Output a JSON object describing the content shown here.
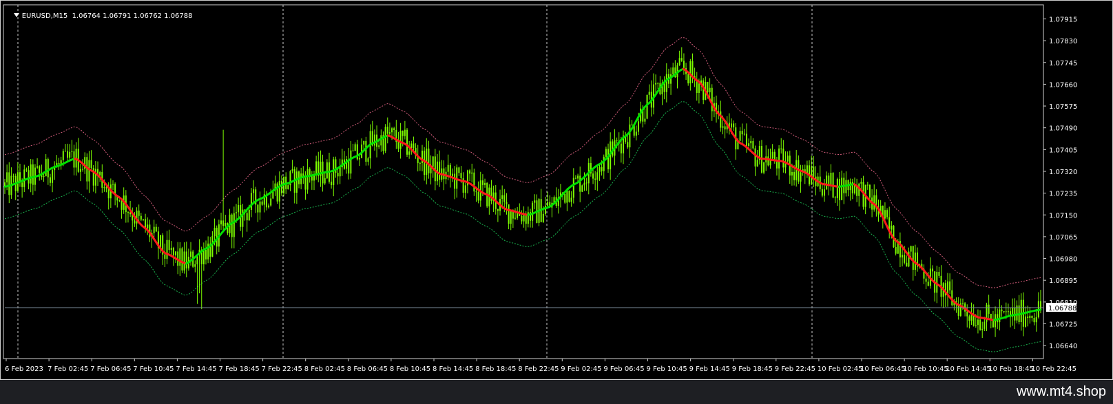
{
  "header": {
    "symbol": "EURUSD,M15",
    "ohlc": "1.06764 1.06791 1.06762 1.06788"
  },
  "watermark": "www.mt4.shop",
  "colors": {
    "background": "#000000",
    "candles": "#7cfc00",
    "ma_up": "#00e000",
    "ma_down": "#ff1a1a",
    "ma_flat": "#ffd700",
    "band_upper": "#d05c7a",
    "band_lower": "#19b24d",
    "grid": "#c8c8c8",
    "bid_line": "#7a8a99"
  },
  "chart_data": {
    "type": "candlestick",
    "symbol": "EURUSD",
    "timeframe": "M15",
    "current_price": 1.06788,
    "y_ticks": [
      1.07915,
      1.0783,
      1.07745,
      1.0766,
      1.07575,
      1.0749,
      1.07405,
      1.0732,
      1.07235,
      1.0715,
      1.07065,
      1.0698,
      1.06895,
      1.0681,
      1.06725,
      1.0664
    ],
    "ylim": [
      1.066,
      1.0797
    ],
    "x_ticks": [
      "6 Feb 2023",
      "7 Feb 02:45",
      "7 Feb 06:45",
      "7 Feb 10:45",
      "7 Feb 14:45",
      "7 Feb 18:45",
      "7 Feb 22:45",
      "8 Feb 02:45",
      "8 Feb 06:45",
      "8 Feb 10:45",
      "8 Feb 14:45",
      "8 Feb 18:45",
      "8 Feb 22:45",
      "9 Feb 02:45",
      "9 Feb 06:45",
      "9 Feb 10:45",
      "9 Feb 14:45",
      "9 Feb 18:45",
      "9 Feb 22:45",
      "10 Feb 02:45",
      "10 Feb 06:45",
      "10 Feb 10:45",
      "10 Feb 14:45",
      "10 Feb 18:45",
      "10 Feb 22:45"
    ],
    "day_separators": [
      "7 Feb 00:00",
      "8 Feb 00:00",
      "9 Feb 00:00",
      "10 Feb 00:00"
    ],
    "ma_profile": [
      [
        0.0,
        1.0726
      ],
      [
        0.03,
        1.073
      ],
      [
        0.05,
        1.0734
      ],
      [
        0.068,
        1.0737
      ],
      [
        0.085,
        1.0732
      ],
      [
        0.11,
        1.0722
      ],
      [
        0.135,
        1.071
      ],
      [
        0.155,
        1.07
      ],
      [
        0.175,
        1.0696
      ],
      [
        0.195,
        1.0702
      ],
      [
        0.22,
        1.0712
      ],
      [
        0.245,
        1.0721
      ],
      [
        0.27,
        1.0727
      ],
      [
        0.29,
        1.073
      ],
      [
        0.315,
        1.0732
      ],
      [
        0.34,
        1.0738
      ],
      [
        0.355,
        1.0743
      ],
      [
        0.37,
        1.0746
      ],
      [
        0.385,
        1.0743
      ],
      [
        0.405,
        1.0736
      ],
      [
        0.42,
        1.0731
      ],
      [
        0.445,
        1.0728
      ],
      [
        0.465,
        1.0723
      ],
      [
        0.485,
        1.0717
      ],
      [
        0.505,
        1.0715
      ],
      [
        0.525,
        1.0718
      ],
      [
        0.55,
        1.0727
      ],
      [
        0.575,
        1.0735
      ],
      [
        0.6,
        1.0746
      ],
      [
        0.62,
        1.0758
      ],
      [
        0.64,
        1.0768
      ],
      [
        0.655,
        1.0772
      ],
      [
        0.67,
        1.0767
      ],
      [
        0.69,
        1.0754
      ],
      [
        0.71,
        1.0743
      ],
      [
        0.73,
        1.0737
      ],
      [
        0.75,
        1.0736
      ],
      [
        0.77,
        1.0732
      ],
      [
        0.79,
        1.0727
      ],
      [
        0.805,
        1.0726
      ],
      [
        0.82,
        1.0727
      ],
      [
        0.84,
        1.0719
      ],
      [
        0.86,
        1.0705
      ],
      [
        0.88,
        1.0696
      ],
      [
        0.9,
        1.0688
      ],
      [
        0.92,
        1.068
      ],
      [
        0.94,
        1.0675
      ],
      [
        0.955,
        1.0674
      ],
      [
        0.975,
        1.0676
      ],
      [
        1.0,
        1.0678
      ]
    ],
    "band_offset": 0.00125
  }
}
